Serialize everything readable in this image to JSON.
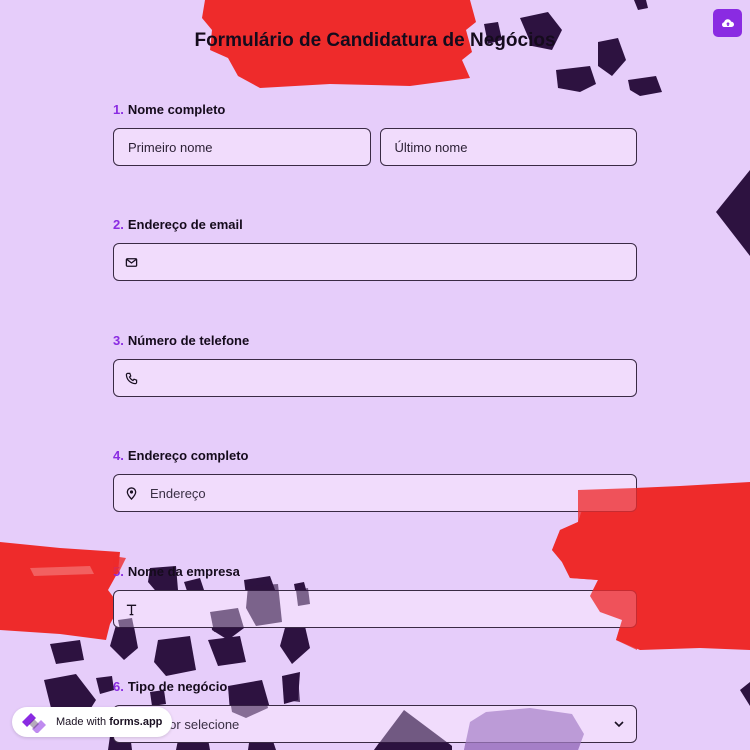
{
  "form": {
    "title": "Formulário de Candidatura de Negócios"
  },
  "toolbar": {
    "save_icon": "cloud-upload-icon"
  },
  "questions": [
    {
      "number": "1.",
      "label": "Nome completo",
      "first_placeholder": "Primeiro nome",
      "last_placeholder": "Último nome"
    },
    {
      "number": "2.",
      "label": "Endereço de email",
      "icon": "envelope-icon"
    },
    {
      "number": "3.",
      "label": "Número de telefone",
      "icon": "phone-icon"
    },
    {
      "number": "4.",
      "label": "Endereço completo",
      "icon": "map-pin-icon",
      "placeholder": "Endereço"
    },
    {
      "number": "5.",
      "label": "Nome da empresa",
      "icon": "text-icon"
    },
    {
      "number": "6.",
      "label": "Tipo de negócio",
      "placeholder": "Por favor selecione",
      "icon": "chevron-down-icon"
    }
  ],
  "branding": {
    "prefix": "Made with",
    "brand": "forms.app"
  },
  "colors": {
    "background": "#e6cdfa",
    "accent": "#8a2be2",
    "field_bg": "#f1dcfc",
    "paint_red": "#ee2b2b",
    "paint_dark": "#2d1240"
  }
}
